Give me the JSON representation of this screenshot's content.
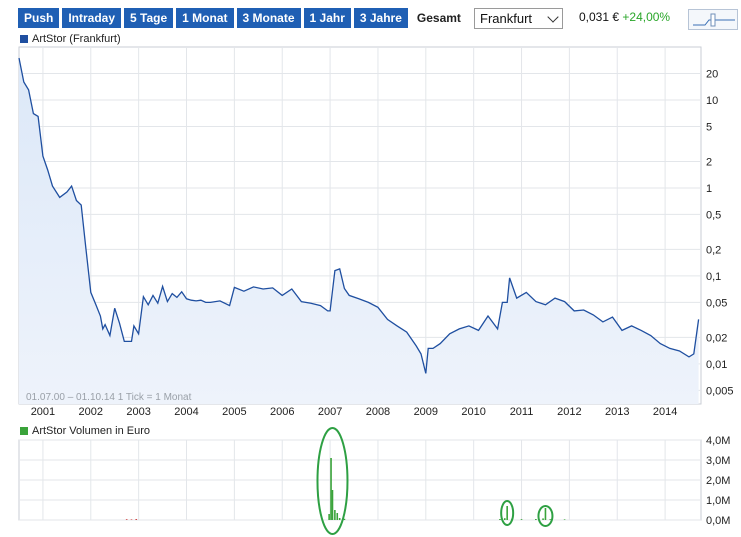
{
  "tabs": [
    "Push",
    "Intraday",
    "5 Tage",
    "1 Monat",
    "3 Monate",
    "1 Jahr",
    "3 Jahre",
    "Gesamt"
  ],
  "active_tab": "Gesamt",
  "exchange": {
    "selected": "Frankfurt"
  },
  "quote": {
    "price": "0,031 €",
    "change": "+24,00%"
  },
  "colors": {
    "price_line": "#1f4fa0",
    "price_fill": "#dce8f8",
    "volume": "#3aa33a",
    "volume_alt": "#cc4444",
    "highlight": "#2ea043",
    "tab_bg": "#1f5fb4"
  },
  "chart_data": [
    {
      "type": "area",
      "legend": "ArtStor (Frankfurt)",
      "yscale": "log",
      "ylim": [
        0.0035,
        40
      ],
      "yticks": [
        "20",
        "10",
        "5",
        "2",
        "1",
        "0,5",
        "0,2",
        "0,1",
        "0,05",
        "0,02",
        "0,01",
        "0,005"
      ],
      "xticks": [
        "2001",
        "2002",
        "2003",
        "2004",
        "2005",
        "2006",
        "2007",
        "2008",
        "2009",
        "2010",
        "2011",
        "2012",
        "2013",
        "2014"
      ],
      "xlim": [
        2000.5,
        2014.75
      ],
      "note": "01.07.00 – 01.10.14   1 Tick = 1 Monat",
      "grid": true,
      "series": [
        {
          "name": "ArtStor (Frankfurt)",
          "x": [
            2000.5,
            2000.6,
            2000.7,
            2000.8,
            2000.9,
            2001.0,
            2001.1,
            2001.2,
            2001.35,
            2001.5,
            2001.6,
            2001.7,
            2001.8,
            2001.9,
            2002.0,
            2002.1,
            2002.2,
            2002.25,
            2002.3,
            2002.4,
            2002.5,
            2002.6,
            2002.7,
            2002.85,
            2002.9,
            2003.0,
            2003.1,
            2003.2,
            2003.3,
            2003.4,
            2003.5,
            2003.6,
            2003.7,
            2003.8,
            2003.9,
            2004.0,
            2004.1,
            2004.2,
            2004.3,
            2004.4,
            2004.5,
            2004.7,
            2004.9,
            2005.0,
            2005.2,
            2005.4,
            2005.6,
            2005.8,
            2006.0,
            2006.2,
            2006.4,
            2006.6,
            2006.8,
            2006.95,
            2007.0,
            2007.1,
            2007.2,
            2007.3,
            2007.4,
            2007.6,
            2007.8,
            2008.0,
            2008.2,
            2008.4,
            2008.6,
            2008.8,
            2008.9,
            2009.0,
            2009.05,
            2009.15,
            2009.3,
            2009.5,
            2009.7,
            2009.9,
            2010.1,
            2010.3,
            2010.5,
            2010.6,
            2010.7,
            2010.75,
            2010.9,
            2011.1,
            2011.3,
            2011.5,
            2011.7,
            2011.9,
            2012.1,
            2012.3,
            2012.5,
            2012.7,
            2012.9,
            2013.1,
            2013.3,
            2013.5,
            2013.7,
            2013.9,
            2014.1,
            2014.3,
            2014.5,
            2014.6,
            2014.7
          ],
          "y": [
            30,
            16,
            13,
            7,
            6.5,
            2.3,
            1.6,
            1.05,
            0.78,
            0.9,
            1.05,
            0.72,
            0.64,
            0.2,
            0.065,
            0.048,
            0.035,
            0.025,
            0.028,
            0.021,
            0.043,
            0.029,
            0.018,
            0.018,
            0.027,
            0.022,
            0.058,
            0.047,
            0.06,
            0.049,
            0.076,
            0.051,
            0.063,
            0.057,
            0.066,
            0.055,
            0.053,
            0.052,
            0.053,
            0.05,
            0.05,
            0.052,
            0.046,
            0.074,
            0.067,
            0.075,
            0.071,
            0.073,
            0.06,
            0.071,
            0.051,
            0.049,
            0.046,
            0.04,
            0.04,
            0.115,
            0.12,
            0.072,
            0.06,
            0.055,
            0.05,
            0.044,
            0.032,
            0.027,
            0.023,
            0.016,
            0.013,
            0.0078,
            0.015,
            0.015,
            0.017,
            0.022,
            0.025,
            0.027,
            0.024,
            0.035,
            0.025,
            0.05,
            0.05,
            0.095,
            0.056,
            0.065,
            0.051,
            0.047,
            0.056,
            0.051,
            0.04,
            0.041,
            0.036,
            0.03,
            0.034,
            0.024,
            0.027,
            0.024,
            0.021,
            0.017,
            0.015,
            0.014,
            0.012,
            0.013,
            0.032
          ]
        }
      ]
    },
    {
      "type": "bar",
      "legend": "ArtStor Volumen in Euro",
      "ylim": [
        0,
        4000000
      ],
      "yticks": [
        "4,0M",
        "3,0M",
        "2,0M",
        "1,0M",
        "0,0M"
      ],
      "grid": true,
      "series": [
        {
          "name": "ArtStor Volumen in Euro",
          "x": [
            2002.75,
            2002.85,
            2002.95,
            2006.98,
            2007.02,
            2007.05,
            2007.1,
            2007.15,
            2007.2,
            2007.3,
            2010.55,
            2010.65,
            2010.7,
            2010.8,
            2011.0,
            2011.3,
            2011.45,
            2011.5,
            2011.6,
            2011.9
          ],
          "y": [
            40000,
            30000,
            50000,
            300000,
            3100000,
            1500000,
            500000,
            350000,
            100000,
            60000,
            50000,
            90000,
            700000,
            60000,
            40000,
            50000,
            80000,
            600000,
            40000,
            30000
          ]
        }
      ]
    }
  ]
}
